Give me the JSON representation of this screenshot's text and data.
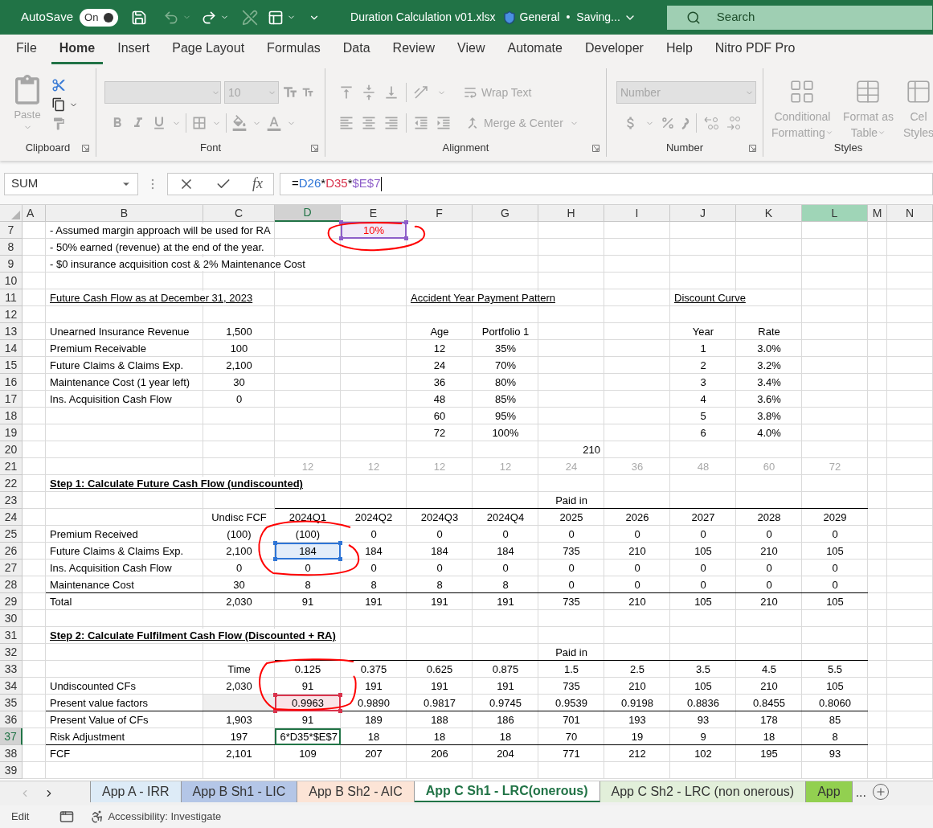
{
  "title_bar": {
    "autosave": {
      "label": "AutoSave",
      "state": "On",
      "on": true
    },
    "file_name": "Duration Calculation v01.xlsx",
    "label": "General",
    "separator": "•",
    "status": "Saving...",
    "search": {
      "placeholder": "Search"
    }
  },
  "tabs": [
    {
      "label": "File",
      "selected": false
    },
    {
      "label": "Home",
      "selected": true
    },
    {
      "label": "Insert",
      "selected": false
    },
    {
      "label": "Page Layout",
      "selected": false
    },
    {
      "label": "Formulas",
      "selected": false
    },
    {
      "label": "Data",
      "selected": false
    },
    {
      "label": "Review",
      "selected": false
    },
    {
      "label": "View",
      "selected": false
    },
    {
      "label": "Automate",
      "selected": false
    },
    {
      "label": "Developer",
      "selected": false
    },
    {
      "label": "Help",
      "selected": false
    },
    {
      "label": "Nitro PDF Pro",
      "selected": false
    }
  ],
  "ribbon": {
    "disabled": true,
    "groups": [
      {
        "kind": "clipboard",
        "label": "Clipboard",
        "launcher": true,
        "paste": "Paste"
      },
      {
        "kind": "font",
        "label": "Font",
        "launcher": true,
        "font_size": "10"
      },
      {
        "kind": "alignment",
        "label": "Alignment",
        "launcher": true,
        "wrap_text": "Wrap Text",
        "merge": "Merge & Center"
      },
      {
        "kind": "number",
        "label": "Number",
        "launcher": true,
        "format": "Number"
      },
      {
        "kind": "styles",
        "label": "Styles",
        "launcher": false,
        "buttons": [
          [
            "Conditional",
            "Formatting"
          ],
          [
            "Format as",
            "Table"
          ],
          [
            "Cel",
            "Styles"
          ]
        ]
      }
    ]
  },
  "formula_bar": {
    "name_box": "SUM",
    "function_label": "fx",
    "formula": [
      {
        "text": "="
      },
      {
        "text": "D26",
        "color": "#2e75d6"
      },
      {
        "text": "*"
      },
      {
        "text": "D35",
        "color": "#d9334c"
      },
      {
        "text": "*"
      },
      {
        "text": "$E$7",
        "color": "#8e5ec9"
      }
    ]
  },
  "sheet": {
    "columns": [
      {
        "label": "A",
        "active": false,
        "selected": false
      },
      {
        "label": "B",
        "active": false,
        "selected": false
      },
      {
        "label": "C",
        "active": false,
        "selected": false
      },
      {
        "label": "D",
        "active": true,
        "selected": false
      },
      {
        "label": "E",
        "active": false,
        "selected": false
      },
      {
        "label": "F",
        "active": false,
        "selected": false
      },
      {
        "label": "G",
        "active": false,
        "selected": false
      },
      {
        "label": "H",
        "active": false,
        "selected": false
      },
      {
        "label": "I",
        "active": false,
        "selected": false
      },
      {
        "label": "J",
        "active": false,
        "selected": false
      },
      {
        "label": "K",
        "active": false,
        "selected": false
      },
      {
        "label": "L",
        "active": false,
        "selected": true
      },
      {
        "label": "M",
        "active": false,
        "selected": false
      },
      {
        "label": "N",
        "active": false,
        "selected": false
      }
    ],
    "rows": [
      {
        "number": "7",
        "active": false,
        "kind": "text",
        "cells": [
          "",
          "- Assumed margin approach will be used for RA",
          "",
          "",
          {
            "text": "10%",
            "kind": "alert",
            "color": "#8e5ec9"
          }
        ]
      },
      {
        "number": "8",
        "active": false,
        "kind": "text",
        "cells": [
          "",
          "- 50% earned (revenue) at the end of the year."
        ]
      },
      {
        "number": "9",
        "active": false,
        "kind": "text",
        "cells": [
          "",
          "- $0 insurance acquisition cost & 2% Maintenance Cost"
        ]
      },
      {
        "number": "10",
        "active": false,
        "kind": "text",
        "cells": []
      },
      {
        "number": "11",
        "active": false,
        "kind": "title",
        "cells": [
          "",
          "Future Cash Flow as at December 31, 2023",
          "",
          "",
          "",
          "Accident Year Payment Pattern",
          "",
          "",
          "",
          "Discount Curve"
        ]
      },
      {
        "number": "12",
        "active": false,
        "kind": "text",
        "cells": []
      },
      {
        "number": "13",
        "active": false,
        "kind": "text",
        "cells": [
          "",
          "Unearned Insurance Revenue",
          "1,500",
          "",
          "",
          "Age",
          "Portfolio 1",
          "",
          "",
          "Year",
          "Rate"
        ]
      },
      {
        "number": "14",
        "active": false,
        "kind": "text",
        "cells": [
          "",
          "Premium Receivable",
          "100",
          "",
          "",
          "12",
          "35%",
          "",
          "",
          "1",
          "3.0%"
        ]
      },
      {
        "number": "15",
        "active": false,
        "kind": "text",
        "cells": [
          "",
          "Future Claims & Claims Exp.",
          "2,100",
          "",
          "",
          "24",
          "70%",
          "",
          "",
          "2",
          "3.2%"
        ]
      },
      {
        "number": "16",
        "active": false,
        "kind": "text",
        "cells": [
          "",
          "Maintenance Cost (1 year left)",
          "30",
          "",
          "",
          "36",
          "80%",
          "",
          "",
          "3",
          "3.4%"
        ]
      },
      {
        "number": "17",
        "active": false,
        "kind": "text",
        "cells": [
          "",
          "Ins. Acquisition Cash Flow",
          "0",
          "",
          "",
          "48",
          "85%",
          "",
          "",
          "4",
          "3.6%"
        ]
      },
      {
        "number": "18",
        "active": false,
        "kind": "text",
        "cells": [
          "",
          "",
          "",
          "",
          "",
          "60",
          "95%",
          "",
          "",
          "5",
          "3.8%"
        ]
      },
      {
        "number": "19",
        "active": false,
        "kind": "text",
        "cells": [
          "",
          "",
          "",
          "",
          "",
          "72",
          "100%",
          "",
          "",
          "6",
          "4.0%"
        ]
      },
      {
        "number": "20",
        "active": false,
        "kind": "text",
        "cells": [
          "",
          "",
          "",
          "",
          "",
          "",
          "",
          {
            "text": "210",
            "kind": "right"
          }
        ]
      },
      {
        "number": "21",
        "active": false,
        "kind": "faint",
        "cells": [
          "",
          "",
          "",
          "12",
          "12",
          "12",
          "12",
          "24",
          "36",
          "48",
          "60",
          "72"
        ]
      },
      {
        "number": "22",
        "active": false,
        "kind": "step_title",
        "cells": [
          "",
          "Step 1:  Calculate Future Cash Flow (undiscounted)"
        ]
      },
      {
        "number": "23",
        "active": false,
        "kind": "text",
        "cells": [
          "",
          "",
          "",
          "",
          "",
          "",
          "",
          "Paid in"
        ]
      },
      {
        "number": "24",
        "active": false,
        "kind": "column_heads",
        "cells": [
          "",
          "",
          "Undisc FCF",
          "2024Q1",
          "2024Q2",
          "2024Q3",
          "2024Q4",
          "2025",
          "2026",
          "2027",
          "2028",
          "2029"
        ]
      },
      {
        "number": "25",
        "active": false,
        "kind": "text",
        "cells": [
          "",
          "Premium Received",
          "(100)",
          "(100)",
          "0",
          "0",
          "0",
          "0",
          "0",
          "0",
          "0",
          "0"
        ]
      },
      {
        "number": "26",
        "active": false,
        "kind": "text",
        "cells": [
          "",
          "Future Claims & Claims Exp.",
          "2,100",
          {
            "text": "184",
            "color": "#2e75d6"
          },
          "184",
          "184",
          "184",
          "735",
          "210",
          "105",
          "210",
          "105"
        ]
      },
      {
        "number": "27",
        "active": false,
        "kind": "text",
        "cells": [
          "",
          "Ins. Acquisition Cash Flow",
          "0",
          "0",
          "0",
          "0",
          "0",
          "0",
          "0",
          "0",
          "0",
          "0"
        ]
      },
      {
        "number": "28",
        "active": false,
        "kind": "text",
        "cells": [
          "",
          "Maintenance Cost",
          "30",
          "8",
          "8",
          "8",
          "8",
          "0",
          "0",
          "0",
          "0",
          "0"
        ]
      },
      {
        "number": "29",
        "active": false,
        "kind": "total",
        "cells": [
          "",
          "Total",
          "2,030",
          "91",
          "191",
          "191",
          "191",
          "735",
          "210",
          "105",
          "210",
          "105"
        ]
      },
      {
        "number": "30",
        "active": false,
        "kind": "text",
        "cells": []
      },
      {
        "number": "31",
        "active": false,
        "kind": "step_title",
        "cells": [
          "",
          "Step 2: Calculate Fulfilment Cash Flow (Discounted + RA)"
        ]
      },
      {
        "number": "32",
        "active": false,
        "kind": "text",
        "cells": [
          "",
          "",
          "",
          "",
          "",
          "",
          "",
          "Paid in"
        ]
      },
      {
        "number": "33",
        "active": false,
        "kind": "column_heads",
        "cells": [
          "",
          "",
          "Time",
          "0.125",
          "0.375",
          "0.625",
          "0.875",
          "1.5",
          "2.5",
          "3.5",
          "4.5",
          "5.5"
        ]
      },
      {
        "number": "34",
        "active": false,
        "kind": "text",
        "cells": [
          "",
          "Undiscounted CFs",
          "2,030",
          "91",
          "191",
          "191",
          "191",
          "735",
          "210",
          "105",
          "210",
          "105"
        ]
      },
      {
        "number": "35",
        "active": false,
        "kind": "text",
        "cells": [
          "",
          "Present value factors",
          {
            "shaded": true
          },
          {
            "text": "0.9963",
            "color": "#d9334c"
          },
          "0.9890",
          "0.9817",
          "0.9745",
          "0.9539",
          "0.9198",
          "0.8836",
          "0.8455",
          "0.8060"
        ]
      },
      {
        "number": "36",
        "active": false,
        "kind": "total",
        "cells": [
          "",
          "Present Value of CFs",
          "1,903",
          "91",
          "189",
          "188",
          "186",
          "701",
          "193",
          "93",
          "178",
          "85"
        ]
      },
      {
        "number": "37",
        "active": true,
        "kind": "text",
        "cells": [
          "",
          "Risk Adjustment",
          "197",
          {
            "text": "6*D35*$E$7",
            "editing": true
          },
          "18",
          "18",
          "18",
          "70",
          "19",
          "9",
          "18",
          "8"
        ]
      },
      {
        "number": "38",
        "active": false,
        "kind": "total",
        "cells": [
          "",
          "FCF",
          "2,101",
          "109",
          "207",
          "206",
          "204",
          "771",
          "212",
          "102",
          "195",
          "93"
        ]
      },
      {
        "number": "39",
        "active": false,
        "kind": "text",
        "cells": []
      }
    ]
  },
  "sheet_tabs": {
    "tabs": [
      {
        "label": "App A - IRR",
        "color": "#ddebf7",
        "selected": false
      },
      {
        "label": "App B Sh1 - LIC",
        "color": "#b4c6e7",
        "selected": false
      },
      {
        "label": "App B Sh2 - AIC",
        "color": "#fce4d6",
        "selected": false
      },
      {
        "label": "App C Sh1 - LRC(onerous)",
        "color": "#ffffff",
        "selected": true
      },
      {
        "label": "App C Sh2 - LRC (non onerous)",
        "color": "#e2efda",
        "selected": false
      },
      {
        "label": "App",
        "color": "#92d050",
        "selected": false
      }
    ],
    "more": "..."
  },
  "status_bar": {
    "mode": "Edit",
    "accessibility": "Accessibility: Investigate"
  }
}
